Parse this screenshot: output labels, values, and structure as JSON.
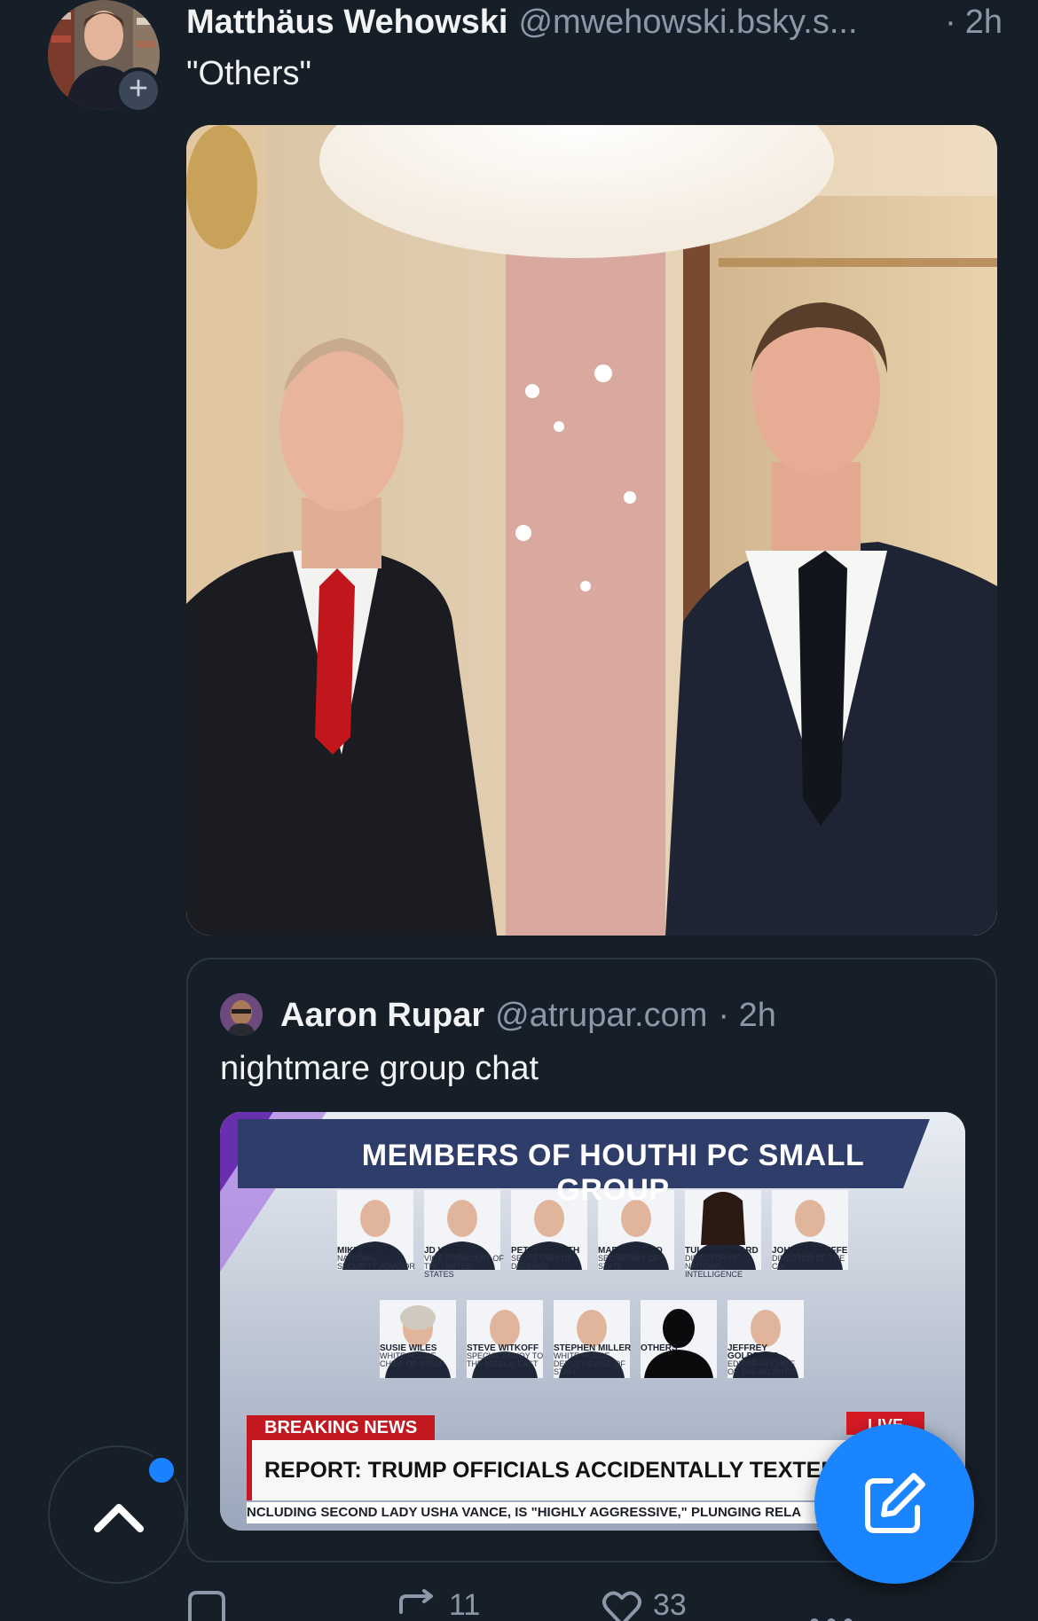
{
  "post": {
    "author": {
      "name": "Matthäus Wehowski",
      "handle": "@mwehowski.bsky.s...",
      "avatar_icon": "author-avatar",
      "follow_icon": "plus-icon"
    },
    "dot": "·",
    "time": "2h",
    "text": "\"Others\""
  },
  "quote": {
    "author": {
      "name": "Aaron Rupar",
      "handle": "@atrupar.com",
      "avatar_icon": "quoted-author-avatar"
    },
    "time": "· 2h",
    "text": "nightmare group chat",
    "graphic": {
      "title": "MEMBERS OF HOUTHI PC SMALL GROUP",
      "people_row1": [
        {
          "name": "MIKE WALTZ",
          "role": "NATIONAL SECURITY ADVISOR"
        },
        {
          "name": "JD VANCE",
          "role": "VICE PRESIDENT OF THE UNITED STATES"
        },
        {
          "name": "PETE HEGSETH",
          "role": "SECRETARY OF DEFENSE"
        },
        {
          "name": "MARCO RUBIO",
          "role": "SECRETARY OF STATE"
        },
        {
          "name": "TULSI GABBARD",
          "role": "DIRECTOR OF NATIONAL INTELLIGENCE"
        },
        {
          "name": "JOHN RATCLIFFE",
          "role": "DIRECTOR OF THE CIA"
        }
      ],
      "people_row2": [
        {
          "name": "SUSIE WILES",
          "role": "WHITE HOUSE CHIEF OF STAFF"
        },
        {
          "name": "STEVE WITKOFF",
          "role": "SPECIAL ENVOY TO THE MIDDLE EAST"
        },
        {
          "name": "STEPHEN MILLER",
          "role": "WHITE HOUSE DEPUTY CHIEF OF STAFF"
        },
        {
          "name": "OTHERS",
          "role": ""
        },
        {
          "name": "JEFFREY GOLDBERG",
          "role": "EDITOR-IN-CHIEF OF THE ATLANTIC"
        }
      ],
      "breaking_label": "BREAKING NEWS",
      "live_label": "LIVE",
      "headline": "REPORT: TRUMP OFFICIALS ACCIDENTALLY TEXTED WAR PLANS TO REPORTER",
      "ticker": "NCLUDING SECOND LADY USHA VANCE, IS \"HIGHLY AGGRESSIVE,\" PLUNGING RELA"
    }
  },
  "actions": {
    "reply_count": "",
    "repost_count": "11",
    "like_count": "33",
    "reply_icon": "reply-icon",
    "repost_icon": "repost-icon",
    "like_icon": "heart-icon",
    "more_icon": "more-icon"
  },
  "controls": {
    "scroll_top_icon": "chevron-up-icon",
    "compose_icon": "compose-icon"
  },
  "colors": {
    "background": "#161e27",
    "accent": "#1b85ff",
    "muted_text": "#8b98a9",
    "breaking_red": "#c41820"
  }
}
